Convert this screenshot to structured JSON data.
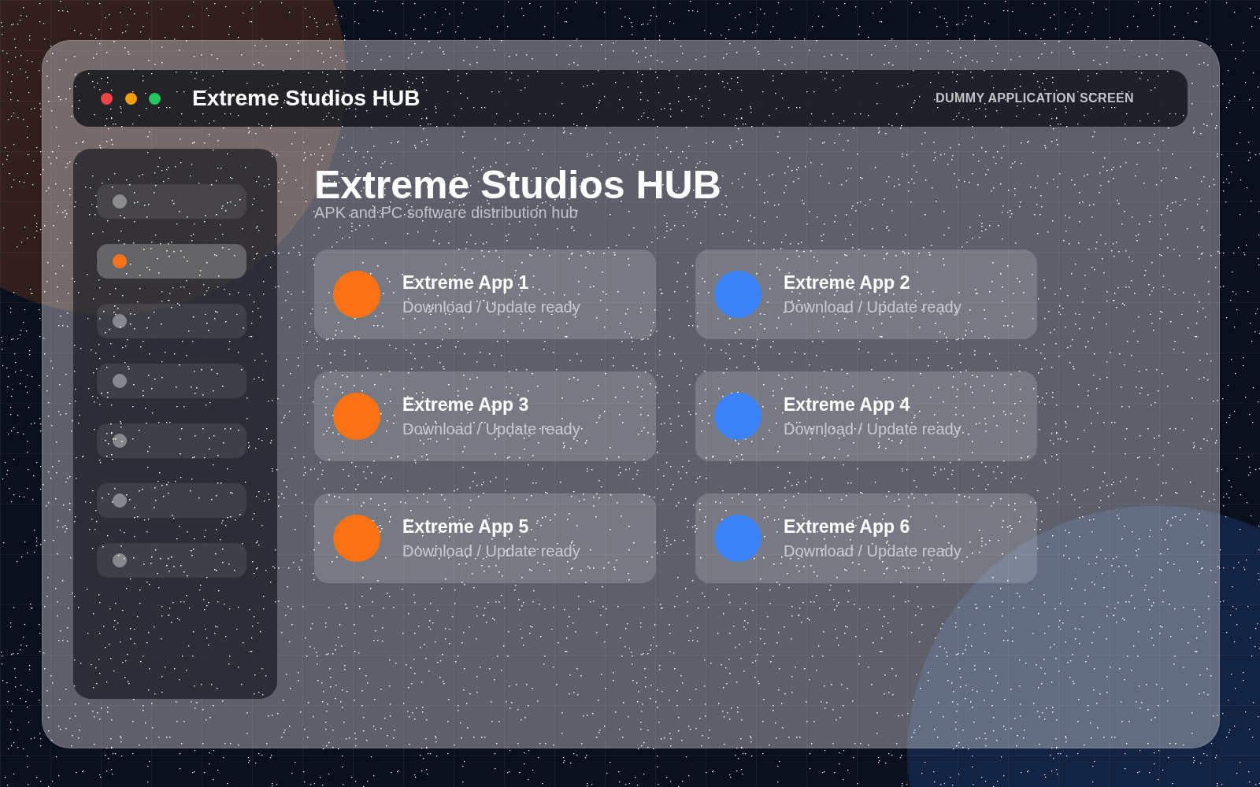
{
  "window": {
    "controls": [
      {
        "color": "#ef4444"
      },
      {
        "color": "#f59e0b"
      },
      {
        "color": "#22c55e"
      }
    ],
    "title": "Extreme Studios HUB",
    "caption": "DUMMY APPLICATION SCREEN"
  },
  "sidebar": {
    "items": [
      {
        "selected": false
      },
      {
        "selected": true
      },
      {
        "selected": false
      },
      {
        "selected": false
      },
      {
        "selected": false
      },
      {
        "selected": false
      },
      {
        "selected": false
      }
    ]
  },
  "header": {
    "title": "Extreme Studios HUB",
    "subtitle": "APK and PC software distribution hub"
  },
  "apps": [
    {
      "name": "Extreme App 1",
      "status": "Download / Update ready",
      "color": "#f97316"
    },
    {
      "name": "Extreme App 2",
      "status": "Download / Update ready",
      "color": "#3b82f6"
    },
    {
      "name": "Extreme App 3",
      "status": "Download / Update ready",
      "color": "#f97316"
    },
    {
      "name": "Extreme App 4",
      "status": "Download / Update ready",
      "color": "#3b82f6"
    },
    {
      "name": "Extreme App 5",
      "status": "Download / Update ready",
      "color": "#f97316"
    },
    {
      "name": "Extreme App 6",
      "status": "Download / Update ready",
      "color": "#3b82f6"
    }
  ]
}
